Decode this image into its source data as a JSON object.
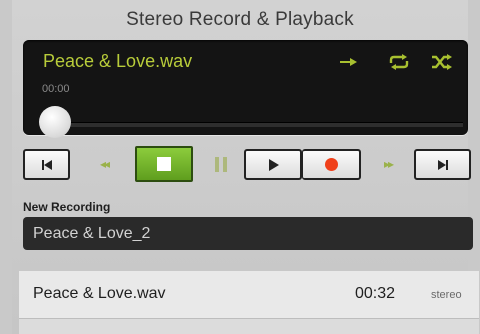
{
  "app": {
    "title": "Stereo Record & Playback"
  },
  "player": {
    "track_title": "Peace & Love.wav",
    "elapsed": "00:00",
    "progress": 0.0,
    "icons": [
      "arrow-right-icon",
      "repeat-icon",
      "shuffle-icon"
    ]
  },
  "transport": {
    "buttons": [
      "skip-back-icon",
      "rewind-icon",
      "stop-icon",
      "pause-icon",
      "play-icon",
      "record-icon",
      "fast-forward-icon",
      "skip-forward-icon"
    ],
    "active": "stop",
    "accent_color": "#6fb12a",
    "record_color": "#f0401a"
  },
  "new_recording": {
    "label": "New Recording",
    "value": "Peace & Love_2"
  },
  "recordings": [
    {
      "name": "Peace & Love.wav",
      "duration": "00:32",
      "channels": "stereo"
    }
  ],
  "colors": {
    "track_title": "#b8cc3a",
    "panel": "#141414",
    "background": "#c9c9c9"
  }
}
